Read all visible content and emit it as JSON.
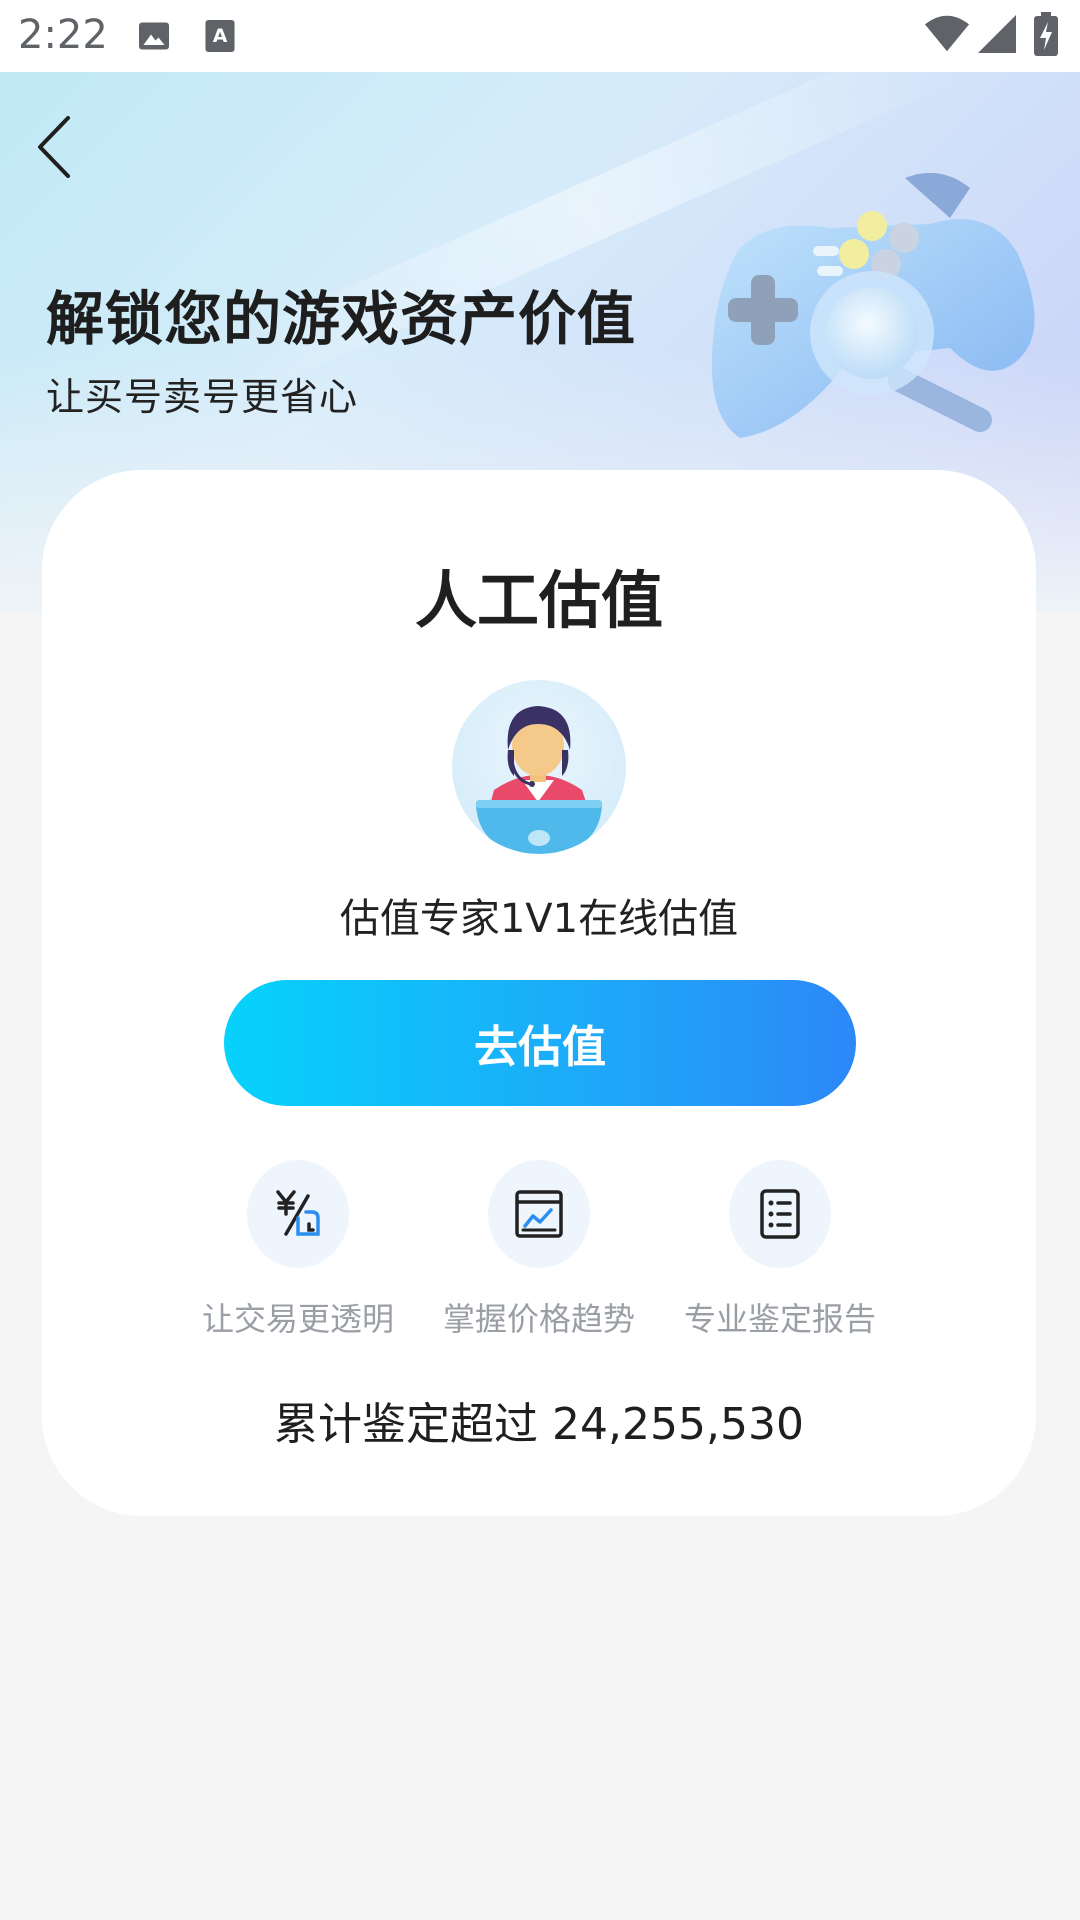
{
  "status_bar": {
    "time": "2:22",
    "icons": [
      "image-icon",
      "text-a-icon",
      "wifi-icon",
      "signal-icon",
      "battery-charging-icon"
    ]
  },
  "hero": {
    "title": "解锁您的游戏资产价值",
    "subtitle": "让买号卖号更省心",
    "illustration": "gamepad-magnifier-illustration"
  },
  "card": {
    "title": "人工估值",
    "avatar": "customer-service-agent-avatar",
    "description": "估值专家1V1在线估值",
    "cta_label": "去估值",
    "features": [
      {
        "icon": "yen-exchange-icon",
        "label": "让交易更透明"
      },
      {
        "icon": "price-trend-chart-icon",
        "label": "掌握价格趋势"
      },
      {
        "icon": "report-document-icon",
        "label": "专业鉴定报告"
      }
    ],
    "total_prefix": "累计鉴定超过",
    "total_count": "24,255,530"
  },
  "colors": {
    "cta_gradient_start": "#06d2fb",
    "cta_gradient_end": "#2c88f7",
    "feature_icon_bg": "#eef5fd",
    "feature_label": "#9a9ea5"
  }
}
